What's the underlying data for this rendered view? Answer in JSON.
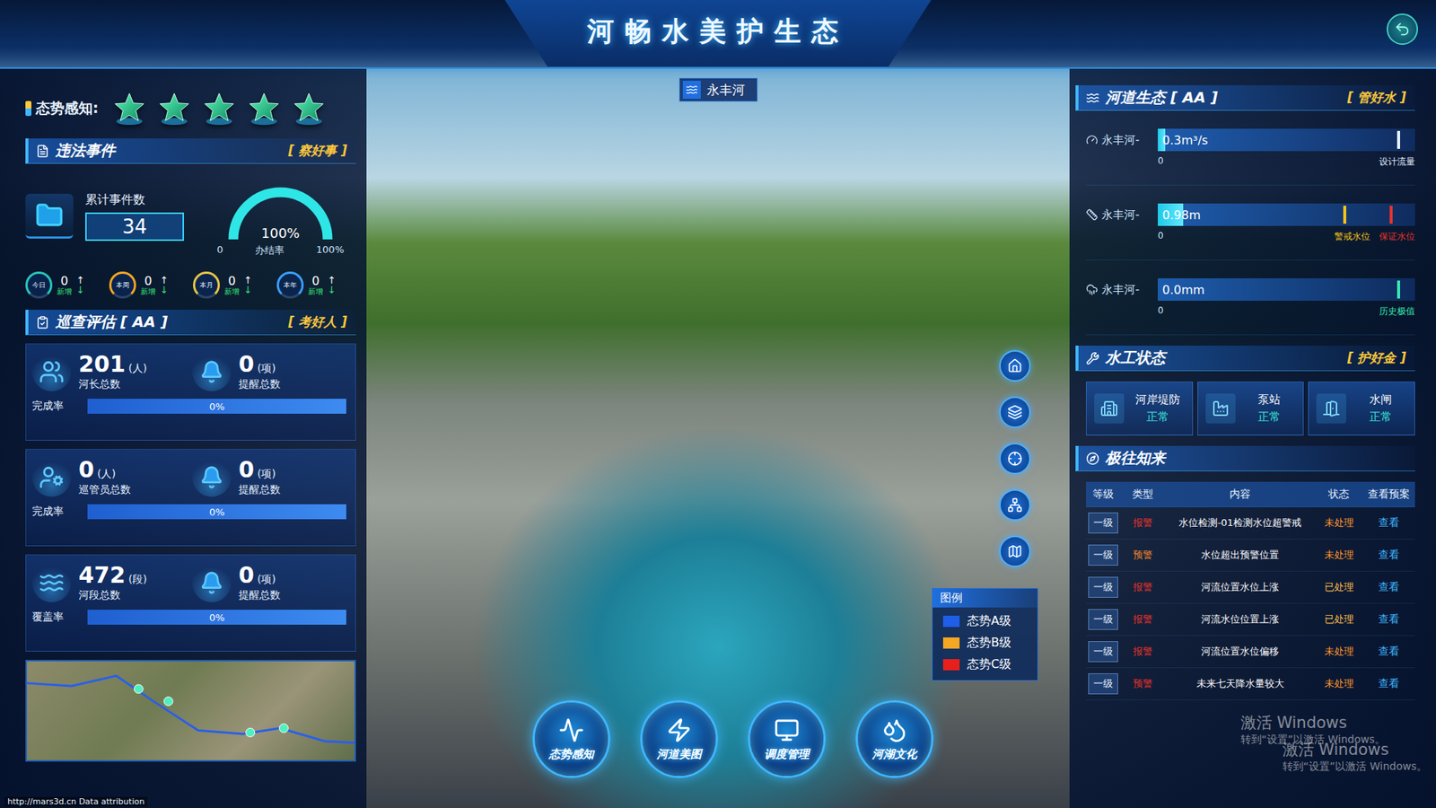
{
  "window": {
    "title": "河畅水美护生态"
  },
  "river": {
    "name": "永丰河"
  },
  "situation": {
    "label": "态势感知:",
    "stars": 5,
    "max_stars": 5
  },
  "violations": {
    "title": "违法事件",
    "motto": "[ 察好事 ]",
    "total_label": "累计事件数",
    "total": "34",
    "rate": "100%",
    "rate_label": "办结率",
    "level": 1,
    "gauge_min": "0",
    "gauge_max": "100%",
    "periods": [
      {
        "badge": "今日",
        "value": "0",
        "note": "新增",
        "up": "↑",
        "down": "↓",
        "color": "#27c6b8"
      },
      {
        "badge": "本周",
        "value": "0",
        "note": "新增",
        "up": "↑",
        "down": "↓",
        "color": "#f5a623"
      },
      {
        "badge": "本月",
        "value": "0",
        "note": "新增",
        "up": "↑",
        "down": "↓",
        "color": "#e8c547"
      },
      {
        "badge": "本年",
        "value": "0",
        "note": "新增",
        "up": "↑",
        "down": "↓",
        "color": "#3aa0ff"
      }
    ]
  },
  "patrol": {
    "title": "巡查评估 [ AA ]",
    "motto": "[ 考好人 ]",
    "cards": [
      {
        "value": "201",
        "unit": "(人)",
        "label": "河长总数",
        "remind_value": "0",
        "remind_unit": "(项)",
        "remind_label": "提醒总数",
        "rate_label": "完成率",
        "rate": "0%",
        "level": 0
      },
      {
        "value": "0",
        "unit": "(人)",
        "label": "巡管员总数",
        "remind_value": "0",
        "remind_unit": "(项)",
        "remind_label": "提醒总数",
        "rate_label": "完成率",
        "rate": "0%",
        "level": 0
      },
      {
        "value": "472",
        "unit": "(段)",
        "label": "河段总数",
        "remind_value": "0",
        "remind_unit": "(项)",
        "remind_label": "提醒总数",
        "rate_label": "覆盖率",
        "rate": "0%",
        "level": 0
      }
    ]
  },
  "ecology": {
    "title": "河道生态 [ AA ]",
    "motto": "[ 管好水 ]",
    "meters": [
      {
        "name": "永丰河-",
        "value": "0.3m³/s",
        "min": "0",
        "level": 0.03,
        "marks": [
          {
            "label": "设计流量",
            "level": 0.93,
            "color": "#e6f2ff"
          }
        ]
      },
      {
        "name": "永丰河-",
        "value": "0.98m",
        "min": "0",
        "level": 0.1,
        "marks": [
          {
            "label": "警戒水位",
            "level": 0.72,
            "color": "#f5c518"
          },
          {
            "label": "保证水位",
            "level": 0.9,
            "color": "#e8332c"
          }
        ]
      },
      {
        "name": "永丰河-",
        "value": "0.0mm",
        "min": "0",
        "level": 0,
        "marks": [
          {
            "label": "历史极值",
            "level": 0.93,
            "color": "#39e6b0"
          }
        ]
      }
    ]
  },
  "works": {
    "title": "水工状态",
    "motto": "[ 护好金 ]",
    "items": [
      {
        "name": "河岸堤防",
        "status": "正常"
      },
      {
        "name": "泵站",
        "status": "正常"
      },
      {
        "name": "水闸",
        "status": "正常"
      }
    ]
  },
  "alerts": {
    "title": "极往知来",
    "columns": [
      "等级",
      "类型",
      "内容",
      "状态",
      "查看预案"
    ],
    "rows": [
      {
        "grade": "一级",
        "type": "报警",
        "color": "#e8332c",
        "content": "水位检测-01检测水位超警戒",
        "status": "未处理",
        "handled": false,
        "action": "查看"
      },
      {
        "grade": "一级",
        "type": "预警",
        "color": "#f08a2c",
        "content": "水位超出预警位置",
        "status": "未处理",
        "handled": false,
        "action": "查看"
      },
      {
        "grade": "一级",
        "type": "报警",
        "color": "#e8332c",
        "content": "河流位置水位上涨",
        "status": "已处理",
        "handled": true,
        "action": "查看"
      },
      {
        "grade": "一级",
        "type": "报警",
        "color": "#e8332c",
        "content": "河流水位位置上涨",
        "status": "已处理",
        "handled": true,
        "action": "查看"
      },
      {
        "grade": "一级",
        "type": "报警",
        "color": "#e8332c",
        "content": "河流位置水位偏移",
        "status": "未处理",
        "handled": false,
        "action": "查看"
      },
      {
        "grade": "一级",
        "type": "预警",
        "color": "#e8332c",
        "content": "未来七天降水量较大",
        "status": "未处理",
        "handled": false,
        "action": "查看"
      }
    ]
  },
  "legend": {
    "title": "图例",
    "items": [
      {
        "label": "态势A级",
        "color": "#1f5ee8"
      },
      {
        "label": "态势B级",
        "color": "#f5a623"
      },
      {
        "label": "态势C级",
        "color": "#e8201c"
      }
    ]
  },
  "nav": [
    {
      "label": "态势感知",
      "selected": false
    },
    {
      "label": "河道美图",
      "selected": false
    },
    {
      "label": "调度管理",
      "selected": false
    },
    {
      "label": "河湖文化",
      "selected": false
    }
  ],
  "attribution": "http://mars3d.cn Data attribution",
  "watermarks": [
    {
      "title": "激活 Windows",
      "hint": "转到“设置”以激活 Windows。"
    },
    {
      "title": "激活 Windows",
      "hint": "转到“设置”以激活 Windows。"
    }
  ]
}
